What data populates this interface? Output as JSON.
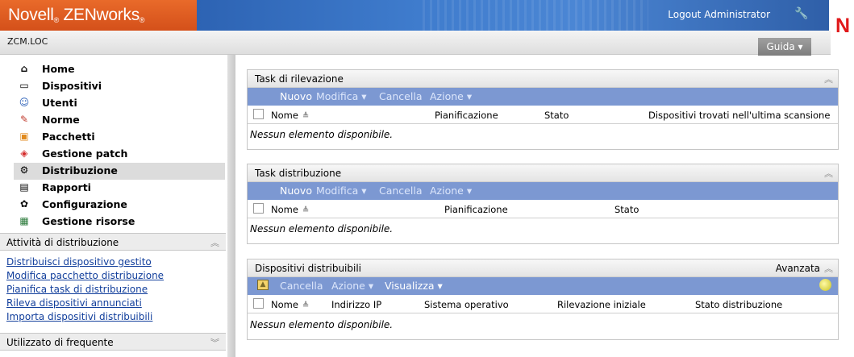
{
  "header": {
    "brand_a": "Novell",
    "brand_b": "ZENworks",
    "brand_reg": "®",
    "logout": "Logout Administrator",
    "zone": "ZCM.LOC",
    "help": "Guida ▾",
    "logo": "N"
  },
  "nav": {
    "items": [
      {
        "label": "Home",
        "icon": "home-icon"
      },
      {
        "label": "Dispositivi",
        "icon": "monitor-icon"
      },
      {
        "label": "Utenti",
        "icon": "user-icon"
      },
      {
        "label": "Norme",
        "icon": "policy-icon"
      },
      {
        "label": "Pacchetti",
        "icon": "package-icon"
      },
      {
        "label": "Gestione patch",
        "icon": "patch-icon"
      },
      {
        "label": "Distribuzione",
        "icon": "deployment-icon",
        "selected": true
      },
      {
        "label": "Rapporti",
        "icon": "report-icon"
      },
      {
        "label": "Configurazione",
        "icon": "configuration-icon"
      },
      {
        "label": "Gestione risorse",
        "icon": "asset-icon"
      }
    ]
  },
  "tasks_panel": {
    "title": "Attività di distribuzione",
    "links": [
      "Distribuisci dispositivo gestito",
      "Modifica pacchetto distribuzione",
      "Pianifica task di distribuzione",
      "Rileva dispositivi annunciati",
      "Importa dispositivi distribuibili"
    ]
  },
  "frequent_panel": {
    "title": "Utilizzato di frequente"
  },
  "panels": [
    {
      "title": "Task di rilevazione",
      "toolbar": [
        "Nuovo",
        "Modifica ▾",
        "Cancella",
        "Azione ▾"
      ],
      "columns": [
        "Nome",
        "Pianificazione",
        "Stato",
        "Dispositivi trovati nell'ultima scansione"
      ],
      "empty": "Nessun elemento disponibile."
    },
    {
      "title": "Task distribuzione",
      "toolbar": [
        "Nuovo",
        "Modifica ▾",
        "Cancella",
        "Azione ▾"
      ],
      "columns": [
        "Nome",
        "Pianificazione",
        "Stato"
      ],
      "empty": "Nessun elemento disponibile."
    },
    {
      "title": "Dispositivi distribuibili",
      "advanced": "Avanzata",
      "toolbar": [
        "Cancella",
        "Azione ▾",
        "Visualizza ▾"
      ],
      "columns": [
        "Nome",
        "Indirizzo IP",
        "Sistema operativo",
        "Rilevazione iniziale",
        "Stato distribuzione"
      ],
      "empty": "Nessun elemento disponibile."
    }
  ],
  "colors": {
    "brand_orange": "#d95b1e",
    "banner_blue": "#3a75c4",
    "toolbar_blue": "#7c98d2",
    "link_blue": "#123f9c",
    "logo_red": "#e0191b"
  }
}
